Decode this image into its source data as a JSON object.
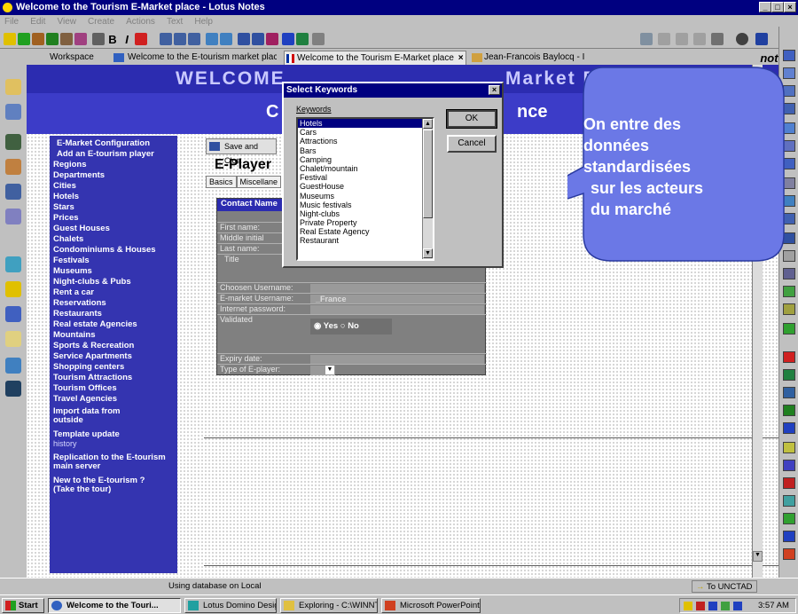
{
  "window": {
    "title": "Welcome to the Tourism E-Market place - Lotus Notes",
    "controls": [
      "_",
      "×"
    ]
  },
  "menu": [
    "File",
    "Edit",
    "View",
    "Create",
    "Actions",
    "Text",
    "Help"
  ],
  "tabs": [
    {
      "label": "Workspace"
    },
    {
      "label": "Welcome to the E-tourism market place"
    },
    {
      "label": "Welcome to the Tourism E-Market place"
    },
    {
      "label": "Jean-Francois Baylocq - Inbox"
    }
  ],
  "tab_close": "×",
  "brand": "notes",
  "banner": {
    "line1_left": "WELCOME",
    "line1_right": "Market Place",
    "line2_left": "C",
    "line2_right": "nce"
  },
  "nav": [
    {
      "label": "E-Market Configuration"
    },
    {
      "label": "Add an E-tourism player"
    },
    {
      "label": "Regions"
    },
    {
      "label": "Departments"
    },
    {
      "label": "Cities"
    },
    {
      "label": "Hotels"
    },
    {
      "label": "Stars"
    },
    {
      "label": "Prices"
    },
    {
      "label": "Guest Houses"
    },
    {
      "label": "Chalets"
    },
    {
      "label": "Condominiums & Houses"
    },
    {
      "label": "Festivals"
    },
    {
      "label": "Museums"
    },
    {
      "label": "Night-clubs & Pubs"
    },
    {
      "label": "Rent a car"
    },
    {
      "label": "Reservations"
    },
    {
      "label": "Restaurants"
    },
    {
      "label": "Real estate Agencies"
    },
    {
      "label": "Mountains"
    },
    {
      "label": "Sports & Recreation"
    },
    {
      "label": "Service Apartments"
    },
    {
      "label": "Shopping centers"
    },
    {
      "label": "Tourism Attractions"
    },
    {
      "label": "Tourism Offices"
    },
    {
      "label": "Travel Agencies"
    },
    {
      "label": "Import data from outside"
    },
    {
      "label": "Template update",
      "sub": "history"
    },
    {
      "label": "Replication to the E-tourism main server"
    },
    {
      "label": "New to the E-tourism ? (Take the tour)"
    }
  ],
  "doc": {
    "save_label": "Save and Clos",
    "heading": "E-Player",
    "subtabs": [
      "Basics",
      "Miscellane"
    ]
  },
  "form": {
    "header": "Contact Name",
    "rows": [
      {
        "label": "First name:",
        "value": ""
      },
      {
        "label": "Middle initial",
        "value": ""
      },
      {
        "label": "Last name:",
        "value": ""
      },
      {
        "label": "Title",
        "value": ""
      },
      {
        "label": "Choosen Username:",
        "value": ""
      },
      {
        "label": "E-market Username:",
        "value": "_France"
      },
      {
        "label": "Internet password:",
        "value": ""
      },
      {
        "label": "Validated",
        "value": ""
      },
      {
        "label": "Expiry date:",
        "value": ""
      },
      {
        "label": "Type of E-player:",
        "value": ""
      }
    ],
    "radio_yes": "Yes",
    "radio_no": "No"
  },
  "dialog": {
    "title": "Select Keywords",
    "close": "×",
    "label": "Keywords",
    "ok": "OK",
    "cancel": "Cancel",
    "items": [
      "Hotels",
      "Cars",
      "Attractions",
      "Bars",
      "Camping",
      "Chalet/mountain",
      "Festival",
      "GuestHouse",
      "Museums",
      "Music festivals",
      "Night-clubs",
      "Private Property",
      "Real Estate Agency",
      "Restaurant"
    ],
    "selected": "Hotels"
  },
  "callout": {
    "lines": [
      "On entre des",
      "données",
      "standardisées",
      "sur les acteurs",
      "du marché"
    ],
    "color": "#6b78e6"
  },
  "status": {
    "text": "Using database on Local",
    "right": "To UNCTAD"
  },
  "taskbar": {
    "start": "Start",
    "tasks": [
      "Welcome to the Touri...",
      "Lotus Domino Designer",
      "Exploring - C:\\WINNT\\Pro...",
      "Microsoft PowerPoint - [Pr..."
    ],
    "time": "3:57 AM"
  }
}
